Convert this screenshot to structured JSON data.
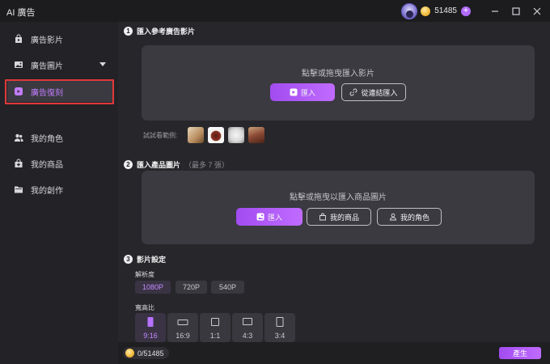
{
  "app": {
    "title": "AI 廣告"
  },
  "titlebar": {
    "credits": "51485",
    "add_label": "+"
  },
  "sidebar": {
    "items": [
      {
        "label": "廣告影片",
        "icon": "bag-video-icon"
      },
      {
        "label": "廣告圖片",
        "icon": "image-icon"
      },
      {
        "label": "廣告復刻",
        "icon": "replicate-icon",
        "active": true
      },
      {
        "label": "我的角色",
        "icon": "users-icon"
      },
      {
        "label": "我的商品",
        "icon": "product-bag-icon"
      },
      {
        "label": "我的創作",
        "icon": "folder-icon"
      }
    ]
  },
  "section1": {
    "num": "1",
    "title": "匯入參考廣告影片",
    "drop_text": "點擊或拖曳匯入影片",
    "import_label": "匯入",
    "link_import_label": "從連結匯入",
    "examples_label": "試試看範例:"
  },
  "section2": {
    "num": "2",
    "title": "匯入產品圖片",
    "note": "（最多 7 張）",
    "drop_text": "點擊或拖曳以匯入商品圖片",
    "import_label": "匯入",
    "my_products_label": "我的商品",
    "my_roles_label": "我的角色"
  },
  "section3": {
    "num": "3",
    "title": "影片設定",
    "resolution_label": "解析度",
    "resolutions": [
      "1080P",
      "720P",
      "540P"
    ],
    "selected_resolution": "1080P",
    "ratio_label": "寬高比",
    "ratios": [
      "9:16",
      "16:9",
      "1:1",
      "4:3",
      "3:4"
    ],
    "selected_ratio": "9:16"
  },
  "bottom": {
    "credit_usage": "0/51485",
    "generate_label": "產生"
  },
  "colors": {
    "accent": "#b26bff",
    "highlight_outline": "#e0383a",
    "background": "#1c1c1f",
    "panel": "#27272b"
  }
}
